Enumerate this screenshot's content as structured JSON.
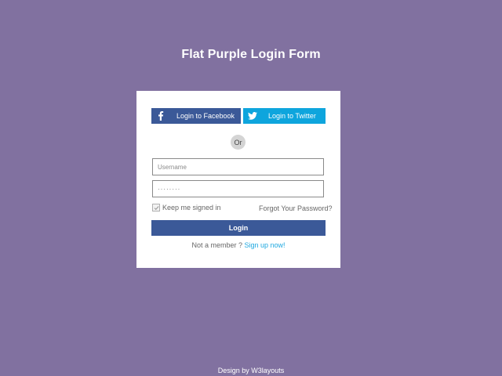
{
  "page": {
    "title": "Flat Purple Login Form",
    "footer": "Design by W3layouts"
  },
  "social": {
    "facebook_label": "Login to Facebook",
    "twitter_label": "Login to Twitter",
    "facebook_icon": "facebook-icon",
    "twitter_icon": "twitter-icon"
  },
  "divider": {
    "or_label": "Or"
  },
  "form": {
    "username_placeholder": "Username",
    "username_value": "",
    "password_value": "········",
    "remember_label": "Keep me signed in",
    "remember_checked": true,
    "forgot_label": "Forgot Your Password?",
    "login_label": "Login",
    "signup_prompt": "Not a member ?",
    "signup_link": "Sign up now!"
  },
  "colors": {
    "background": "#8171a0",
    "facebook": "#3b5998",
    "twitter": "#0ea5dd",
    "login_button": "#3b5998",
    "link": "#1ea8e0"
  }
}
